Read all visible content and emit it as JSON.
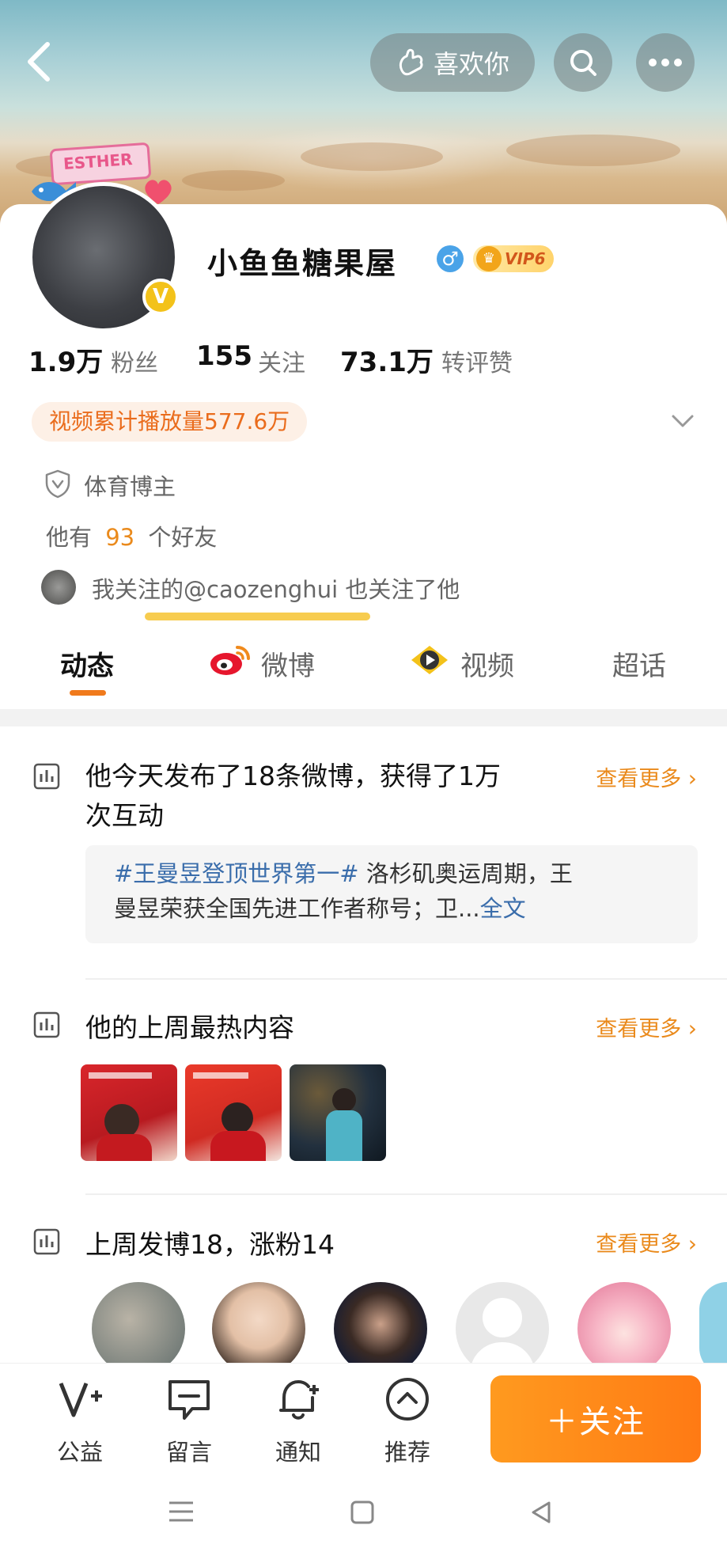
{
  "header": {
    "like_label": "喜欢你"
  },
  "profile": {
    "avatar_caption": "ESTHER",
    "name": "小鱼鱼糖果屋",
    "vip_label": "VIP6",
    "stats": [
      {
        "num": "1.9万",
        "label": "粉丝"
      },
      {
        "num": "155",
        "label": "关注"
      },
      {
        "num": "73.1万",
        "label": "转评赞"
      }
    ],
    "video_plays": "视频累计播放量577.6万",
    "category": "体育博主",
    "friends_prefix": "他有",
    "friends_count": "93",
    "friends_suffix": "个好友",
    "mutual_follow": "我关注的@caozenghui 也关注了他"
  },
  "tabs": [
    {
      "label": "动态"
    },
    {
      "label": "微博"
    },
    {
      "label": "视频"
    },
    {
      "label": "超话"
    }
  ],
  "feed": {
    "section1": {
      "title_line1": "他今天发布了18条微博，获得了1万",
      "title_line2": "次互动",
      "more": "查看更多",
      "hashtag": "#王曼昱登顶世界第一#",
      "text_a": " 洛杉矶奥运周期，王",
      "text_b": "曼昱荣获全国先进工作者称号；卫...",
      "full_text": "全文"
    },
    "section2": {
      "title": "他的上周最热内容",
      "more": "查看更多"
    },
    "section3": {
      "title": "上周发博18，涨粉14",
      "more": "查看更多"
    }
  },
  "bottom_bar": {
    "items": [
      {
        "label": "公益",
        "icon": "charity-icon"
      },
      {
        "label": "留言",
        "icon": "message-icon"
      },
      {
        "label": "通知",
        "icon": "bell-icon"
      },
      {
        "label": "推荐",
        "icon": "recommend-icon"
      }
    ],
    "follow_label": "＋关注"
  },
  "colors": {
    "accent": "#ff8a1a",
    "link": "#3a6dab",
    "vip_gold": "#f2a51a"
  }
}
